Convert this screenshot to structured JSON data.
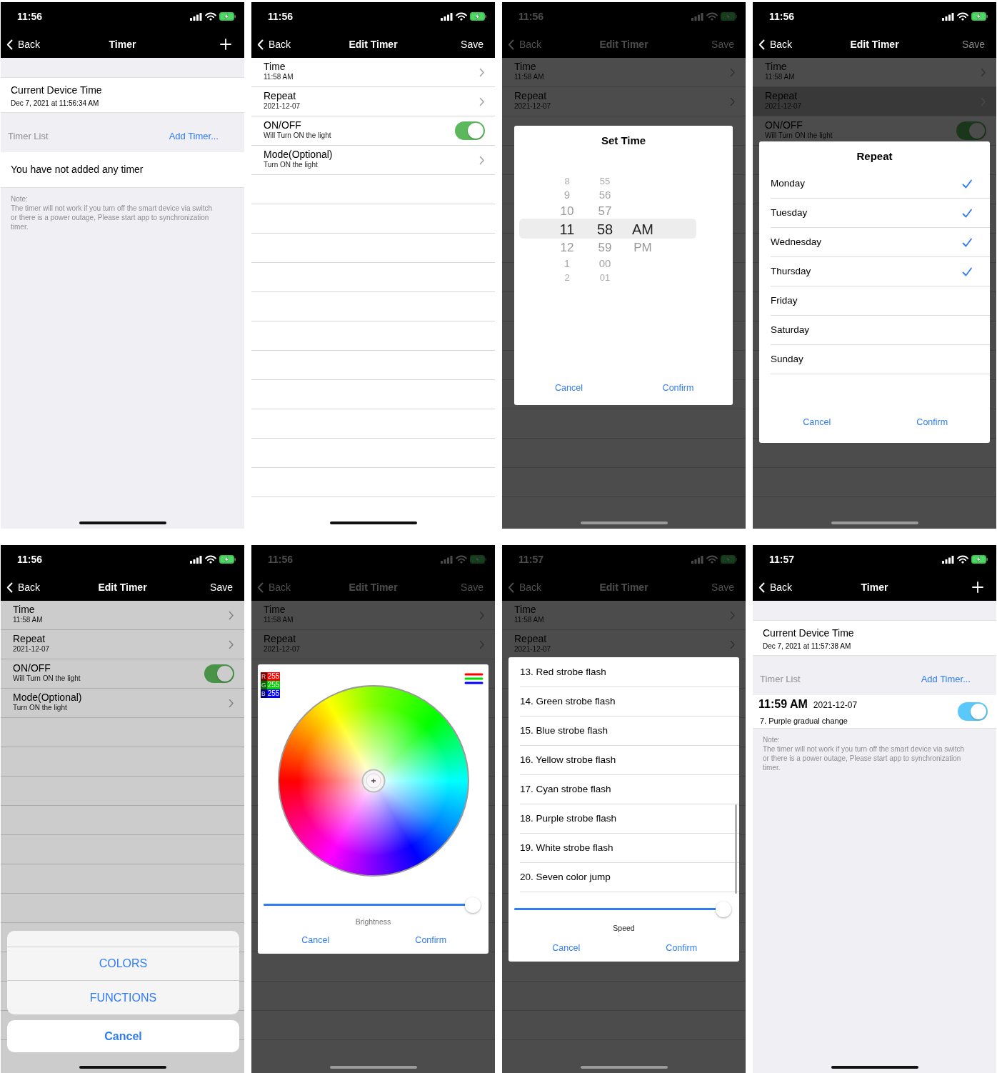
{
  "screens": [
    {
      "kind": "timer_list",
      "status_time": "11:56",
      "nav": {
        "back": "Back",
        "title": "Timer",
        "action": {
          "kind": "plus"
        }
      },
      "device_time": {
        "title": "Current Device Time",
        "value": "Dec 7, 2021 at 11:56:34 AM"
      },
      "section": {
        "title": "Timer List",
        "action": "Add Timer..."
      },
      "empty_text": "You have not added any timer",
      "note": {
        "title": "Note:",
        "text": "The timer will not work if you turn off the smart device via switch or there is a power outage, Please start app to synchronization timer."
      }
    },
    {
      "kind": "edit_timer",
      "status_time": "11:56",
      "nav": {
        "back": "Back",
        "title": "Edit Timer",
        "action": {
          "kind": "text",
          "label": "Save",
          "disabled": false
        }
      },
      "rows": [
        {
          "kind": "link",
          "title": "Time",
          "subtitle": "11:58 AM",
          "selected": false
        },
        {
          "kind": "link",
          "title": "Repeat",
          "subtitle": "2021-12-07",
          "selected": false
        },
        {
          "kind": "toggle",
          "title": "ON/OFF",
          "subtitle": "Will Turn ON the light",
          "on": true,
          "selected": false
        },
        {
          "kind": "link",
          "title": "Mode(Optional)",
          "subtitle": "Turn ON the light",
          "selected": false
        }
      ]
    },
    {
      "kind": "edit_timer",
      "status_time": "11:56",
      "nav": {
        "back": "Back",
        "title": "Edit Timer",
        "action": {
          "kind": "text",
          "label": "Save",
          "disabled": false
        }
      },
      "backdrop": {
        "kind": "dark",
        "covers_nav": true
      },
      "rows": [
        {
          "kind": "link",
          "title": "Time",
          "subtitle": "11:58 AM",
          "selected": false
        },
        {
          "kind": "link",
          "title": "Repeat",
          "subtitle": "2021-12-07",
          "selected": false
        }
      ],
      "overlay": {
        "kind": "time_picker",
        "title": "Set Time",
        "columns": [
          {
            "items": [
              {
                "label": "8",
                "selected": false
              },
              {
                "label": "9",
                "selected": false
              },
              {
                "label": "10",
                "selected": false
              },
              {
                "label": "11",
                "selected": true
              },
              {
                "label": "12",
                "selected": false
              },
              {
                "label": "1",
                "selected": false
              },
              {
                "label": "2",
                "selected": false
              }
            ]
          },
          {
            "items": [
              {
                "label": "55",
                "selected": false
              },
              {
                "label": "56",
                "selected": false
              },
              {
                "label": "57",
                "selected": false
              },
              {
                "label": "58",
                "selected": true
              },
              {
                "label": "59",
                "selected": false
              },
              {
                "label": "00",
                "selected": false
              },
              {
                "label": "01",
                "selected": false
              }
            ]
          },
          {
            "items": [
              {
                "label": "AM",
                "selected": true
              },
              {
                "label": "PM",
                "selected": false
              }
            ]
          }
        ],
        "buttons": [
          "Cancel",
          "Confirm"
        ]
      }
    },
    {
      "kind": "edit_timer",
      "status_time": "11:56",
      "nav": {
        "back": "Back",
        "title": "Edit Timer",
        "action": {
          "kind": "text",
          "label": "Save",
          "disabled": true
        }
      },
      "backdrop": {
        "kind": "dark",
        "covers_nav": false
      },
      "rows": [
        {
          "kind": "link",
          "title": "Time",
          "subtitle": "11:58 AM",
          "selected": false
        },
        {
          "kind": "link",
          "title": "Repeat",
          "subtitle": "2021-12-07",
          "selected": true
        },
        {
          "kind": "toggle",
          "title": "ON/OFF",
          "subtitle": "Will Turn ON the light",
          "on": true,
          "selected": false
        }
      ],
      "overlay": {
        "kind": "repeat",
        "title": "Repeat",
        "days": [
          {
            "label": "Monday",
            "checked": true
          },
          {
            "label": "Tuesday",
            "checked": true
          },
          {
            "label": "Wednesday",
            "checked": true
          },
          {
            "label": "Thursday",
            "checked": true
          },
          {
            "label": "Friday",
            "checked": false
          },
          {
            "label": "Saturday",
            "checked": false
          },
          {
            "label": "Sunday",
            "checked": false
          }
        ],
        "buttons": [
          "Cancel",
          "Confirm"
        ]
      }
    },
    {
      "kind": "edit_timer",
      "status_time": "11:56",
      "nav": {
        "back": "Back",
        "title": "Edit Timer",
        "action": {
          "kind": "text",
          "label": "Save",
          "disabled": false
        }
      },
      "backdrop": {
        "kind": "light",
        "covers_nav": false
      },
      "rows": [
        {
          "kind": "link",
          "title": "Time",
          "subtitle": "11:58 AM",
          "selected": false
        },
        {
          "kind": "link",
          "title": "Repeat",
          "subtitle": "2021-12-07",
          "selected": false
        },
        {
          "kind": "toggle",
          "title": "ON/OFF",
          "subtitle": "Will Turn ON the light",
          "on": true,
          "selected": false
        },
        {
          "kind": "link",
          "title": "Mode(Optional)",
          "subtitle": "Turn ON the light",
          "selected": false
        }
      ],
      "overlay": {
        "kind": "action_sheet",
        "options": [
          "COLORS",
          "FUNCTIONS"
        ],
        "cancel": "Cancel"
      }
    },
    {
      "kind": "edit_timer",
      "status_time": "11:56",
      "nav": {
        "back": "Back",
        "title": "Edit Timer",
        "action": {
          "kind": "text",
          "label": "Save",
          "disabled": false
        }
      },
      "backdrop": {
        "kind": "dark",
        "covers_nav": true
      },
      "rows": [
        {
          "kind": "link",
          "title": "Time",
          "subtitle": "11:58 AM",
          "selected": false
        },
        {
          "kind": "link",
          "title": "Repeat",
          "subtitle": "2021-12-07",
          "selected": false
        }
      ],
      "overlay": {
        "kind": "color_picker",
        "channels": [
          {
            "label": "R",
            "value": "255",
            "color": "#ff0000"
          },
          {
            "label": "G",
            "value": "255",
            "color": "#00d000"
          },
          {
            "label": "B",
            "value": "255",
            "color": "#0000ff"
          }
        ],
        "slider": {
          "level": 0.98,
          "label": "Brightness"
        },
        "buttons": [
          "Cancel",
          "Confirm"
        ]
      }
    },
    {
      "kind": "edit_timer",
      "status_time": "11:57",
      "nav": {
        "back": "Back",
        "title": "Edit Timer",
        "action": {
          "kind": "text",
          "label": "Save",
          "disabled": false
        }
      },
      "backdrop": {
        "kind": "dark",
        "covers_nav": true
      },
      "rows": [
        {
          "kind": "link",
          "title": "Time",
          "subtitle": "11:58 AM",
          "selected": false
        },
        {
          "kind": "link",
          "title": "Repeat",
          "subtitle": "2021-12-07",
          "selected": false
        }
      ],
      "overlay": {
        "kind": "mode_list",
        "modes": [
          "13. Red strobe flash",
          "14. Green strobe flash",
          "15. Blue strobe flash",
          "16. Yellow strobe flash",
          "17. Cyan strobe flash",
          "18. Purple strobe flash",
          "19. White strobe flash",
          "20. Seven color jump"
        ],
        "slider": {
          "level": 0.98,
          "label": "Speed"
        },
        "buttons": [
          "Cancel",
          "Confirm"
        ]
      }
    },
    {
      "kind": "timer_list",
      "status_time": "11:57",
      "nav": {
        "back": "Back",
        "title": "Timer",
        "action": {
          "kind": "plus"
        }
      },
      "device_time": {
        "title": "Current Device Time",
        "value": "Dec 7, 2021 at 11:57:38 AM"
      },
      "section": {
        "title": "Timer List",
        "action": "Add Timer..."
      },
      "timers": [
        {
          "time": "11:59 AM",
          "date": "2021-12-07",
          "mode": "7. Purple gradual change",
          "on": true
        }
      ],
      "note": {
        "title": "Note:",
        "text": "The timer will not work if you turn off the smart device via switch or there is a power outage, Please start app to synchronization timer."
      }
    }
  ]
}
